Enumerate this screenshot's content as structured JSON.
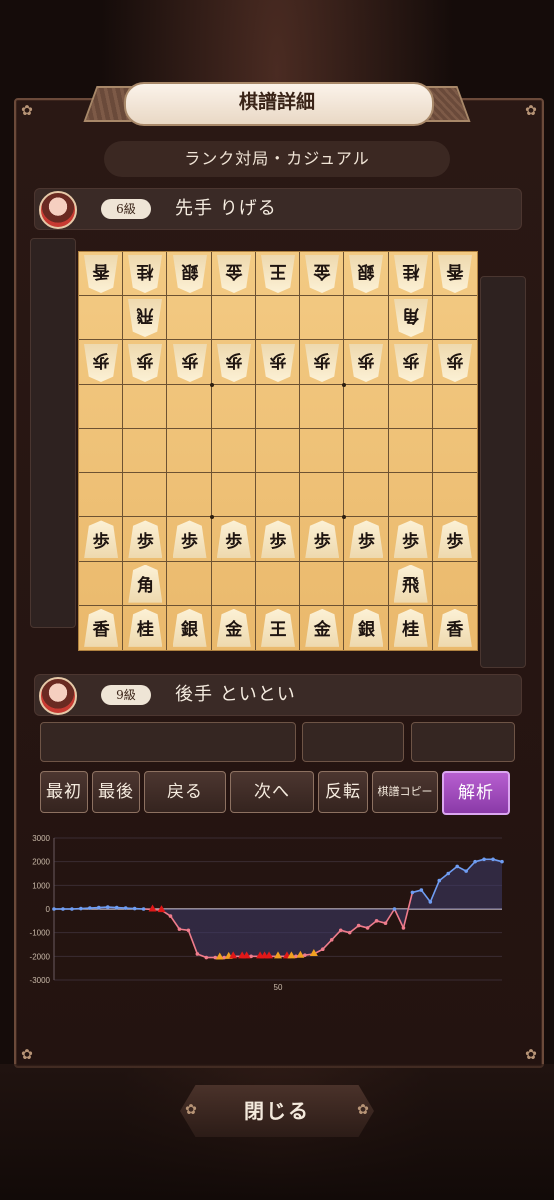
{
  "dialog": {
    "title": "棋譜詳細",
    "mode": "ランク対局・カジュアル",
    "close_label": "閉じる"
  },
  "players": {
    "sente": {
      "rank": "6級",
      "name": "先手 りげる"
    },
    "gote": {
      "rank": "9級",
      "name": "後手 といとい"
    }
  },
  "board": {
    "rows": [
      [
        {
          "c": "香",
          "g": true
        },
        {
          "c": "桂",
          "g": true
        },
        {
          "c": "銀",
          "g": true
        },
        {
          "c": "金",
          "g": true
        },
        {
          "c": "王",
          "g": true
        },
        {
          "c": "金",
          "g": true
        },
        {
          "c": "銀",
          "g": true
        },
        {
          "c": "桂",
          "g": true
        },
        {
          "c": "香",
          "g": true
        }
      ],
      [
        null,
        {
          "c": "飛",
          "g": true
        },
        null,
        null,
        null,
        null,
        null,
        {
          "c": "角",
          "g": true
        },
        null
      ],
      [
        {
          "c": "歩",
          "g": true
        },
        {
          "c": "歩",
          "g": true
        },
        {
          "c": "歩",
          "g": true
        },
        {
          "c": "歩",
          "g": true
        },
        {
          "c": "歩",
          "g": true
        },
        {
          "c": "歩",
          "g": true
        },
        {
          "c": "歩",
          "g": true
        },
        {
          "c": "歩",
          "g": true
        },
        {
          "c": "歩",
          "g": true
        }
      ],
      [
        null,
        null,
        null,
        null,
        null,
        null,
        null,
        null,
        null
      ],
      [
        null,
        null,
        null,
        null,
        null,
        null,
        null,
        null,
        null
      ],
      [
        null,
        null,
        null,
        null,
        null,
        null,
        null,
        null,
        null
      ],
      [
        {
          "c": "歩",
          "g": false
        },
        {
          "c": "歩",
          "g": false
        },
        {
          "c": "歩",
          "g": false
        },
        {
          "c": "歩",
          "g": false
        },
        {
          "c": "歩",
          "g": false
        },
        {
          "c": "歩",
          "g": false
        },
        {
          "c": "歩",
          "g": false
        },
        {
          "c": "歩",
          "g": false
        },
        {
          "c": "歩",
          "g": false
        }
      ],
      [
        null,
        {
          "c": "角",
          "g": false
        },
        null,
        null,
        null,
        null,
        null,
        {
          "c": "飛",
          "g": false
        },
        null
      ],
      [
        {
          "c": "香",
          "g": false
        },
        {
          "c": "桂",
          "g": false
        },
        {
          "c": "銀",
          "g": false
        },
        {
          "c": "金",
          "g": false
        },
        {
          "c": "王",
          "g": false
        },
        {
          "c": "金",
          "g": false
        },
        {
          "c": "銀",
          "g": false
        },
        {
          "c": "桂",
          "g": false
        },
        {
          "c": "香",
          "g": false
        }
      ]
    ]
  },
  "controls": {
    "first": "最初",
    "last": "最後",
    "prev": "戻る",
    "next": "次へ",
    "flip": "反転",
    "copy": "棋譜コピー",
    "analyze": "解析"
  },
  "chart_data": {
    "type": "line",
    "ylim": [
      -3000,
      3000
    ],
    "yticks": [
      "3000",
      "2000",
      "1000",
      "0",
      "-1000",
      "-2000",
      "-3000"
    ],
    "xtick_label": "50",
    "xtick_value": 50,
    "xlim": [
      0,
      100
    ],
    "positive_color": "#6f9df2",
    "negative_color": "#ef7c8c",
    "x": [
      0,
      2,
      4,
      6,
      8,
      10,
      12,
      14,
      16,
      18,
      20,
      22,
      24,
      26,
      28,
      30,
      32,
      34,
      36,
      38,
      40,
      42,
      44,
      46,
      48,
      50,
      52,
      54,
      56,
      58,
      60,
      62,
      64,
      66,
      68,
      70,
      72,
      74,
      76,
      78,
      80,
      82,
      84,
      86,
      88,
      90,
      92,
      94,
      96,
      98,
      100
    ],
    "values": [
      0,
      0,
      0,
      20,
      40,
      60,
      80,
      60,
      40,
      20,
      0,
      -20,
      -50,
      -300,
      -850,
      -900,
      -1900,
      -2050,
      -2050,
      -2050,
      -2000,
      -2000,
      -2000,
      -2000,
      -2000,
      -2000,
      -2000,
      -2000,
      -1950,
      -1900,
      -1700,
      -1300,
      -900,
      -1000,
      -700,
      -800,
      -500,
      -600,
      0,
      -800,
      700,
      800,
      300,
      1200,
      1500,
      1800,
      1600,
      2000,
      2100,
      2100,
      2000
    ],
    "markers": [
      {
        "x": 22,
        "color": "#e01818"
      },
      {
        "x": 24,
        "color": "#e01818"
      },
      {
        "x": 37,
        "color": "#f0a020"
      },
      {
        "x": 39,
        "color": "#f0a020"
      },
      {
        "x": 40,
        "color": "#e01818"
      },
      {
        "x": 42,
        "color": "#e01818"
      },
      {
        "x": 43,
        "color": "#e01818"
      },
      {
        "x": 46,
        "color": "#e01818"
      },
      {
        "x": 47,
        "color": "#e01818"
      },
      {
        "x": 48,
        "color": "#e01818"
      },
      {
        "x": 50,
        "color": "#f0a020"
      },
      {
        "x": 52,
        "color": "#e01818"
      },
      {
        "x": 53,
        "color": "#f0a020"
      },
      {
        "x": 55,
        "color": "#f0a020"
      },
      {
        "x": 58,
        "color": "#f0a020"
      }
    ]
  }
}
